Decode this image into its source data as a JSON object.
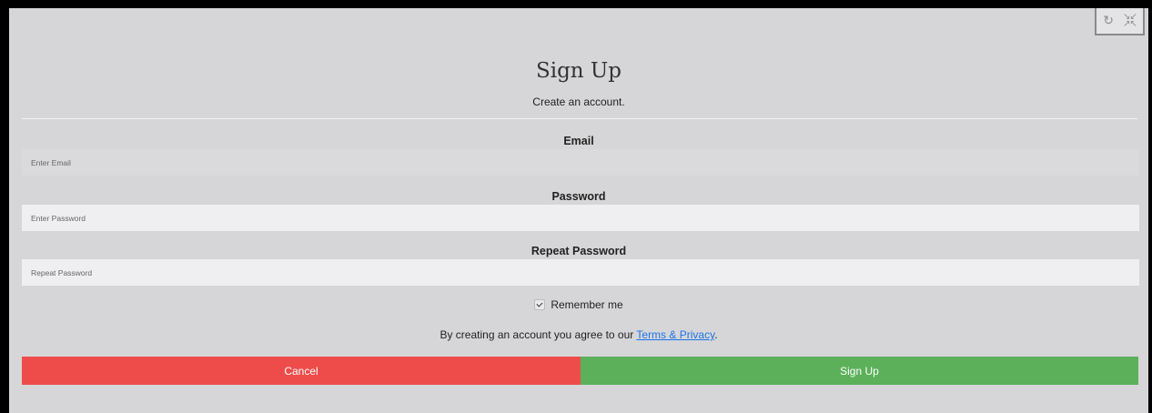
{
  "toolbar": {
    "refresh_icon": "refresh-icon",
    "collapse_icon": "collapse-icon"
  },
  "form": {
    "title": "Sign Up",
    "subtitle": "Create an account.",
    "email_label": "Email",
    "email_placeholder": "Enter Email",
    "password_label": "Password",
    "password_placeholder": "Enter Password",
    "repeat_label": "Repeat Password",
    "repeat_placeholder": "Repeat Password",
    "remember_label": "Remember me",
    "remember_checked": true,
    "terms_prefix": "By creating an account you agree to our ",
    "terms_link": "Terms & Privacy",
    "terms_suffix": ".",
    "cancel_label": "Cancel",
    "signup_label": "Sign Up"
  },
  "colors": {
    "cancel": "#ee4c4a",
    "signup": "#5cb05a",
    "link": "#1e73e8"
  }
}
